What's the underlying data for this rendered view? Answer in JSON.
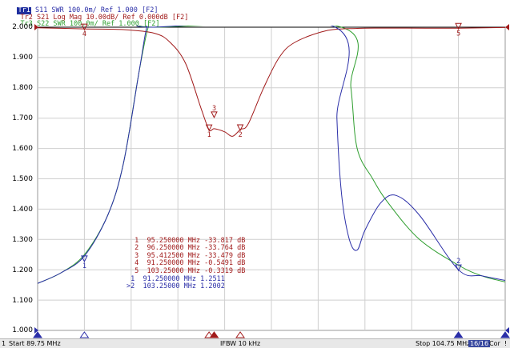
{
  "colors": {
    "tr1": "#2b2fa8",
    "tr2": "#a11a1a",
    "tr3": "#2e9e2e",
    "grid": "#cfcfcf",
    "ref_line": "#000000",
    "status_bg": "#e8e8e8"
  },
  "traces": [
    {
      "badge": "Tr1",
      "text": " S11 SWR 100.0m/ Ref 1.000 [F2]"
    },
    {
      "badge": "Tr2",
      "text": " S21 Log Mag 10.00dB/ Ref 0.000dB [F2]"
    },
    {
      "badge": "Tr3",
      "text": " S22 SWR 100.0m/ Ref 1.000 [F2]"
    }
  ],
  "y_axis_labels": [
    "2.000",
    "1.900",
    "1.800",
    "1.700",
    "1.600",
    "1.500",
    "1.400",
    "1.300",
    "1.200",
    "1.100",
    "1.000"
  ],
  "marker_table_s21": [
    {
      "n": "1",
      "freq": "95.250000 MHz",
      "val": "-33.817 dB"
    },
    {
      "n": "2",
      "freq": "96.250000 MHz",
      "val": "-33.764 dB"
    },
    {
      "n": "3",
      "freq": "95.412500 MHz",
      "val": "-33.479 dB"
    },
    {
      "n": "4",
      "freq": "91.250000 MHz",
      "val": "-0.5491 dB"
    },
    {
      "n": "5",
      "freq": "103.25000 MHz",
      "val": "-0.3319 dB"
    }
  ],
  "marker_table_s11": [
    {
      "n": " 1",
      "freq": "91.250000 MHz",
      "val": "1.2511"
    },
    {
      "n": ">2",
      "freq": "103.25000 MHz",
      "val": "1.2002"
    }
  ],
  "markers_s21": [
    {
      "label": "1",
      "freq_mhz": 95.25,
      "value_db": -33.817
    },
    {
      "label": "2",
      "freq_mhz": 96.25,
      "value_db": -33.764
    },
    {
      "label": "3",
      "freq_mhz": 95.4125,
      "value_db": -33.479
    },
    {
      "label": "4",
      "freq_mhz": 91.25,
      "value_db": -0.5491
    },
    {
      "label": "5",
      "freq_mhz": 103.25,
      "value_db": -0.3319
    }
  ],
  "markers_s11": [
    {
      "label": "1",
      "freq_mhz": 91.25,
      "value": 1.2511
    },
    {
      "label": "2",
      "freq_mhz": 103.25,
      "value": 1.2002
    }
  ],
  "status": {
    "channel": "1",
    "start": "Start 89.75 MHz",
    "ifbw": "IFBW 10 kHz",
    "stop": "Stop 104.75 MHz",
    "points": "16/16",
    "cor": "Cor",
    "mark": "!"
  },
  "chart_data": {
    "type": "line",
    "x_range_mhz": [
      89.75,
      104.75
    ],
    "ylim": [
      1.0,
      2.0
    ],
    "grid": true,
    "series": [
      {
        "name": "S11",
        "unit": "SWR",
        "x": [
          89.75,
          90.5,
          91.25,
          92,
          92.5,
          93,
          93.25,
          93.4,
          99.3,
          99.35,
          99.5,
          99.75,
          100,
          100.25,
          100.75,
          101.25,
          102,
          103.25,
          104,
          104.75
        ],
        "values": [
          1.155,
          1.19,
          1.245,
          1.38,
          1.55,
          1.85,
          2.0,
          2.0,
          2.0,
          1.7,
          1.45,
          1.3,
          1.265,
          1.33,
          1.42,
          1.445,
          1.38,
          1.2,
          1.18,
          1.165
        ]
      },
      {
        "name": "S21",
        "unit": "dB",
        "ref_db": 0,
        "scale_db_per_div": 10,
        "x": [
          89.75,
          91.25,
          92.5,
          93.5,
          94,
          94.5,
          95,
          95.25,
          95.4125,
          95.75,
          96,
          96.25,
          96.5,
          97,
          97.5,
          98,
          99,
          100,
          101,
          103.25,
          104.75
        ],
        "values": [
          -0.2,
          -0.5491,
          -0.8,
          -2,
          -5,
          -12,
          -27,
          -33.817,
          -33.479,
          -34.5,
          -36,
          -33.764,
          -32,
          -20,
          -10,
          -5,
          -1.2,
          -0.4,
          -0.3,
          -0.3319,
          -0.1
        ]
      },
      {
        "name": "S22",
        "unit": "SWR",
        "x": [
          89.75,
          90.5,
          91.25,
          92,
          92.5,
          93,
          93.3,
          93.5,
          99.5,
          99.8,
          100,
          100.5,
          101,
          102,
          103.25,
          104,
          104.75
        ],
        "values": [
          1.155,
          1.19,
          1.25,
          1.38,
          1.55,
          1.85,
          2.0,
          2.0,
          2.0,
          1.8,
          1.6,
          1.5,
          1.42,
          1.3,
          1.215,
          1.18,
          1.16
        ]
      }
    ]
  }
}
